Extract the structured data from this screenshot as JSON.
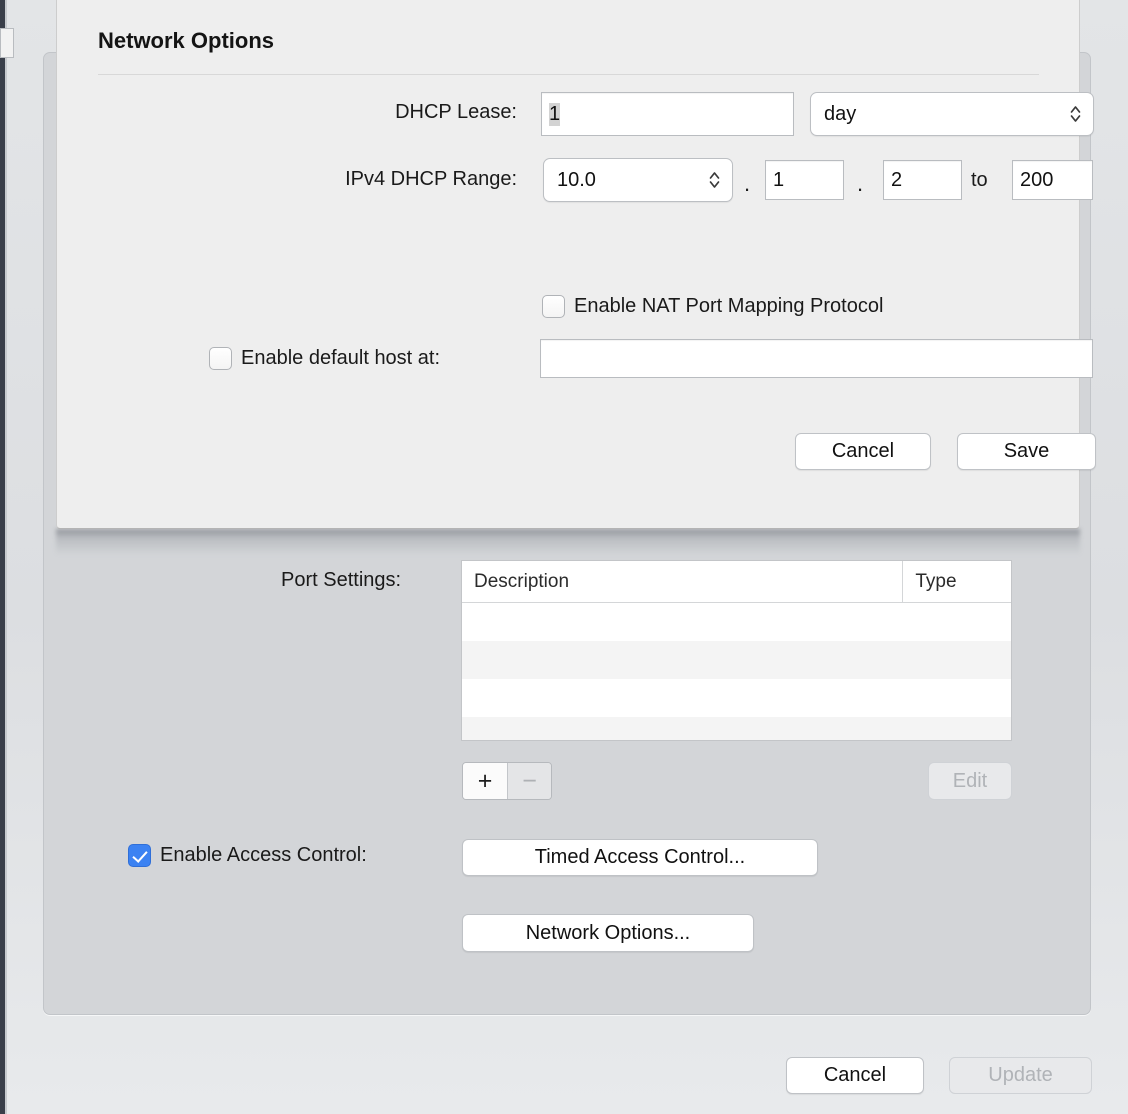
{
  "sheet": {
    "title": "Network Options",
    "fields": {
      "dhcp_lease_label": "DHCP Lease:",
      "dhcp_lease_value": "1",
      "dhcp_lease_unit": "day",
      "ipv4_range_label": "IPv4 DHCP Range:",
      "ipv4_octet1": "10.0",
      "ipv4_dot1": ".",
      "ipv4_octet2": "1",
      "ipv4_dot2": ".",
      "ipv4_octet3": "2",
      "ipv4_to": "to",
      "ipv4_octet4": "200",
      "default_host_value": "",
      "default_host_placeholder": ""
    },
    "checkboxes": {
      "nat_label": "Enable NAT Port Mapping Protocol",
      "nat_checked": false,
      "default_host_label": "Enable default host at:",
      "default_host_checked": false
    },
    "buttons": {
      "cancel": "Cancel",
      "save": "Save"
    }
  },
  "window": {
    "port_settings_label": "Port Settings:",
    "table": {
      "columns": [
        "Description",
        "Type"
      ],
      "rows": [
        [],
        [],
        [],
        []
      ]
    },
    "add_button": "+",
    "remove_button": "−",
    "edit_button": "Edit",
    "access_control_label": "Enable Access Control:",
    "access_control_checked": true,
    "timed_access_button": "Timed Access Control...",
    "network_options_button": "Network Options...",
    "cancel_button": "Cancel",
    "update_button": "Update"
  },
  "colors": {
    "accent": "#3b82f2",
    "sheet_bg": "#eeeeee",
    "panel_bg": "#d3d5d8",
    "window_bg": "#dfe1e3"
  }
}
